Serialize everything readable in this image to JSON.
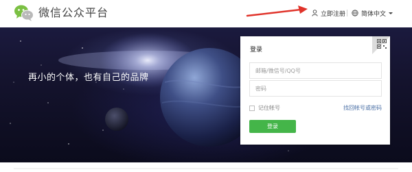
{
  "header": {
    "brand": "微信公众平台",
    "register_label": "立即注册",
    "language_label": "简体中文"
  },
  "banner": {
    "slogan": "再小的个体，也有自己的品牌"
  },
  "login": {
    "title": "登录",
    "account_placeholder": "邮箱/微信号/QQ号",
    "password_placeholder": "密码",
    "remember_label": "记住帐号",
    "forgot_label": "找回帐号或密码",
    "submit_label": "登录"
  },
  "colors": {
    "primary_green": "#44b549",
    "arrow_red": "#e0332a",
    "link_blue": "#4a6fa5"
  }
}
